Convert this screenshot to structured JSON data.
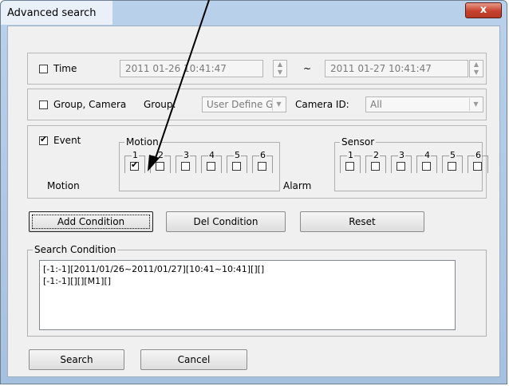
{
  "window": {
    "title": "Advanced search",
    "close_glyph": "x"
  },
  "time": {
    "label": "Time",
    "checked": false,
    "start": "2011 01-26 10:41:47",
    "separator": "~",
    "end": "2011 01-27 10:41:47"
  },
  "group_camera": {
    "label": "Group, Camera",
    "checked": false,
    "group_label": "Group:",
    "group_value": "User Define G",
    "camera_label": "Camera ID:",
    "camera_value": "All"
  },
  "event": {
    "label": "Event",
    "checked": true,
    "motion_legend": "Motion",
    "sensor_legend": "Sensor",
    "motion_row_label": "Motion",
    "alarm_row_label": "Alarm",
    "motion_channels": [
      {
        "num": "1",
        "checked": true
      },
      {
        "num": "2",
        "checked": false
      },
      {
        "num": "3",
        "checked": false
      },
      {
        "num": "4",
        "checked": false
      },
      {
        "num": "5",
        "checked": false
      },
      {
        "num": "6",
        "checked": false
      }
    ],
    "sensor_channels": [
      {
        "num": "1",
        "checked": false
      },
      {
        "num": "2",
        "checked": false
      },
      {
        "num": "3",
        "checked": false
      },
      {
        "num": "4",
        "checked": false
      },
      {
        "num": "5",
        "checked": false
      },
      {
        "num": "6",
        "checked": false
      }
    ]
  },
  "buttons": {
    "add": "Add Condition",
    "del": "Del Condition",
    "reset": "Reset",
    "search": "Search",
    "cancel": "Cancel"
  },
  "search_condition": {
    "legend": "Search Condition",
    "lines": [
      "[-1:-1][2011/01/26~2011/01/27][10:41~10:41][][]",
      "[-1:-1][][][M1][]"
    ]
  }
}
